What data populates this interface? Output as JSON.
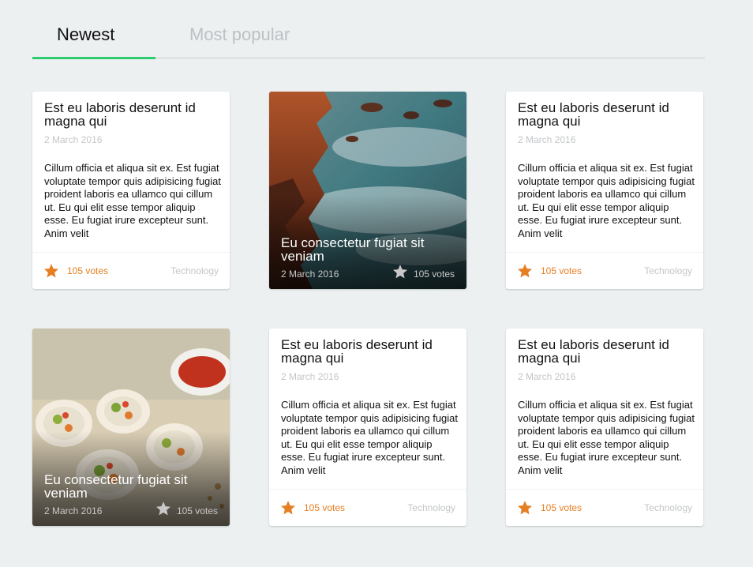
{
  "tabs": [
    {
      "label": "Newest"
    },
    {
      "label": "Most popular"
    }
  ],
  "colors": {
    "accent": "#2ecc71",
    "star": "#e67e22",
    "star_inactive": "#c9c9c9",
    "background": "#edf0f1"
  },
  "cards": [
    {
      "type": "text",
      "title": "Est eu laboris deserunt id magna qui",
      "date": "2 March 2016",
      "excerpt": "Cillum officia et aliqua sit ex. Est fugiat voluptate tempor quis adipisicing fugiat proident laboris ea ullamco qui cillum ut. Eu qui elit esse tempor aliquip esse. Eu fugiat irure excepteur sunt. Anim velit",
      "votes": "105 votes",
      "category": "Technology"
    },
    {
      "type": "image",
      "image": "coastline-photo",
      "title": "Eu consectetur fugiat sit veniam",
      "date": "2 March 2016",
      "votes": "105 votes"
    },
    {
      "type": "text",
      "title": "Est eu laboris deserunt id magna qui",
      "date": "2 March 2016",
      "excerpt": "Cillum officia et aliqua sit ex. Est fugiat voluptate tempor quis adipisicing fugiat proident laboris ea ullamco qui cillum ut. Eu qui elit esse tempor aliquip esse. Eu fugiat irure excepteur sunt. Anim velit",
      "votes": "105 votes",
      "category": "Technology"
    },
    {
      "type": "image",
      "image": "spring-rolls-photo",
      "title": "Eu consectetur fugiat sit veniam",
      "date": "2 March 2016",
      "votes": "105 votes"
    },
    {
      "type": "text",
      "title": "Est eu laboris deserunt id magna qui",
      "date": "2 March 2016",
      "excerpt": "Cillum officia et aliqua sit ex. Est fugiat voluptate tempor quis adipisicing fugiat proident laboris ea ullamco qui cillum ut. Eu qui elit esse tempor aliquip esse. Eu fugiat irure excepteur sunt. Anim velit",
      "votes": "105 votes",
      "category": "Technology"
    },
    {
      "type": "text",
      "title": "Est eu laboris deserunt id magna qui",
      "date": "2 March 2016",
      "excerpt": "Cillum officia et aliqua sit ex. Est fugiat voluptate tempor quis adipisicing fugiat proident laboris ea ullamco qui cillum ut. Eu qui elit esse tempor aliquip esse. Eu fugiat irure excepteur sunt. Anim velit",
      "votes": "105 votes",
      "category": "Technology"
    }
  ]
}
